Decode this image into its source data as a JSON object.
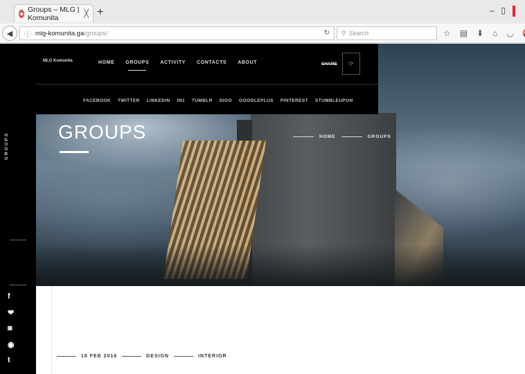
{
  "browser": {
    "tab_title": "Groups – MLG | Komunita",
    "tab_close": "╳",
    "new_tab": "+",
    "window_controls": [
      "–",
      "▯"
    ],
    "url_host": "mlg-komunita.ga",
    "url_path": "/groups/",
    "search_placeholder": "Search",
    "toolbar_icons": [
      "star-icon",
      "reading-list-icon",
      "download-icon",
      "home-icon",
      "pocket-icon",
      "adblock-icon"
    ]
  },
  "site": {
    "logo": "MLG Komunita",
    "menu": [
      "HOME",
      "GROUPS",
      "ACTIVITY",
      "CONTACTS",
      "ABOUT"
    ],
    "active_menu": "GROUPS",
    "share_label": "SHARE",
    "share_links": [
      "FACEBOOK",
      "TWITTER",
      "LINKEDIN",
      "IN1",
      "TUMBLR",
      "DIGG",
      "GOOGLEPLUS",
      "PINTEREST",
      "STUMBLEUPON"
    ],
    "vertical_label": "GROUPS",
    "social_icons": [
      "f",
      "❤",
      "◙",
      "◉",
      "t"
    ]
  },
  "hero": {
    "title": "GROUPS",
    "breadcrumb": [
      "HOME",
      "GROUPS"
    ]
  },
  "post_meta": {
    "date": "18 FEB 2016",
    "category": "DESIGN",
    "tag": "INTERIOR"
  }
}
